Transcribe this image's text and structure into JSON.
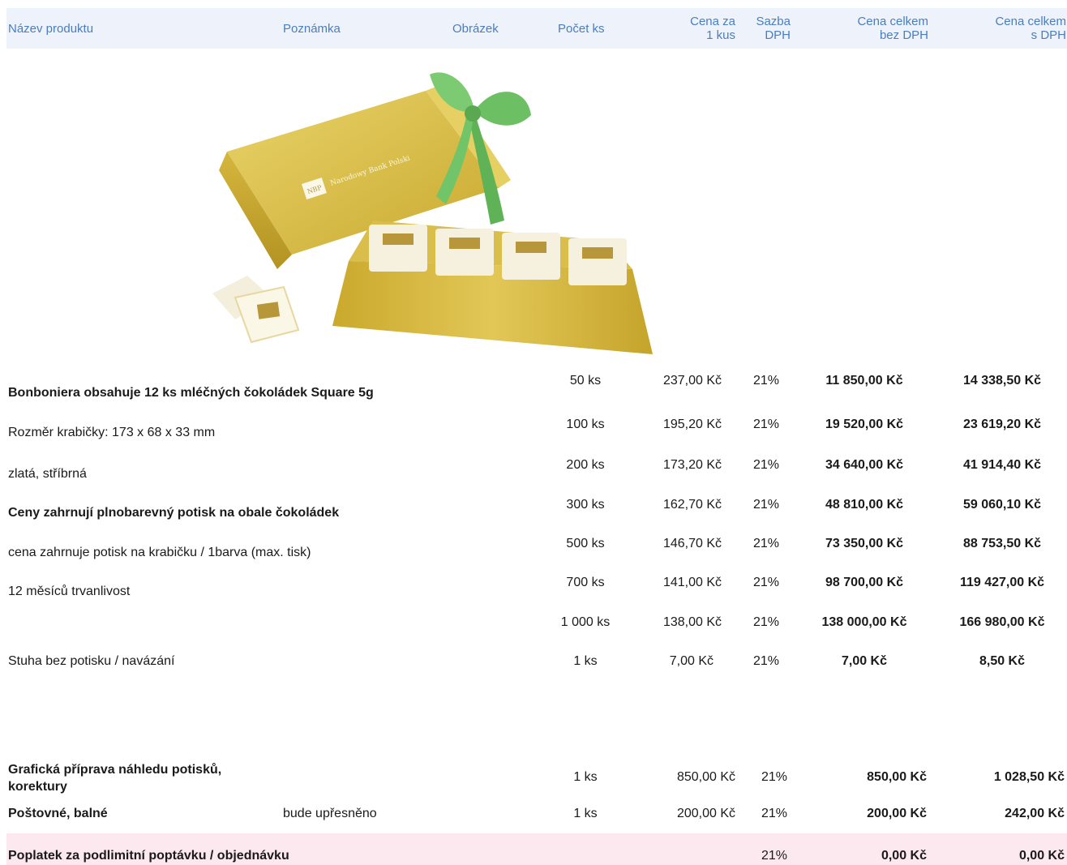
{
  "header": {
    "name": "Název produktu",
    "note": "Poznámka",
    "image": "Obrázek",
    "qty": "Počet ks",
    "unit_price_l1": "Cena za",
    "unit_price_l2": "1 kus",
    "vat_l1": "Sazba",
    "vat_l2": "DPH",
    "total_ex_l1": "Cena celkem",
    "total_ex_l2": "bez DPH",
    "total_inc_l1": "Cena celkem",
    "total_inc_l2": "s DPH"
  },
  "product_image": {
    "box_label": "Narodowy Bank Polski",
    "logo": "NBP"
  },
  "description": [
    "Bonboniera obsahuje 12 ks mléčných čokoládek Square 5g",
    "Rozměr krabičky: 173 x 68 x 33 mm",
    "zlatá, stříbrná",
    "Ceny zahrnují plnobarevný potisk na obale čokoládek",
    "cena zahrnuje potisk na krabičku / 1barva (max. tisk)",
    "12 měsíců trvanlivost"
  ],
  "price_rows": [
    {
      "qty": "50 ks",
      "unit": "237,00 Kč",
      "vat": "21%",
      "total_ex": "11 850,00 Kč",
      "total_inc": "14 338,50 Kč"
    },
    {
      "qty": "100 ks",
      "unit": "195,20 Kč",
      "vat": "21%",
      "total_ex": "19 520,00 Kč",
      "total_inc": "23 619,20 Kč"
    },
    {
      "qty": "200 ks",
      "unit": "173,20 Kč",
      "vat": "21%",
      "total_ex": "34 640,00 Kč",
      "total_inc": "41 914,40 Kč"
    },
    {
      "qty": "300 ks",
      "unit": "162,70 Kč",
      "vat": "21%",
      "total_ex": "48 810,00 Kč",
      "total_inc": "59 060,10 Kč"
    },
    {
      "qty": "500 ks",
      "unit": "146,70 Kč",
      "vat": "21%",
      "total_ex": "73 350,00 Kč",
      "total_inc": "88 753,50 Kč"
    },
    {
      "qty": "700 ks",
      "unit": "141,00 Kč",
      "vat": "21%",
      "total_ex": "98 700,00 Kč",
      "total_inc": "119 427,00 Kč"
    },
    {
      "qty": "1 000 ks",
      "unit": "138,00 Kč",
      "vat": "21%",
      "total_ex": "138 000,00 Kč",
      "total_inc": "166 980,00 Kč"
    }
  ],
  "ribbon": {
    "name": "Stuha bez potisku / navázání",
    "qty": "1 ks",
    "unit": "7,00 Kč",
    "vat": "21%",
    "total_ex": "7,00 Kč",
    "total_inc": "8,50 Kč"
  },
  "graphics": {
    "name_l1": "Grafická příprava náhledu potisků,",
    "name_l2": "korektury",
    "qty": "1 ks",
    "unit": "850,00 Kč",
    "vat": "21%",
    "total_ex": "850,00 Kč",
    "total_inc": "1 028,50 Kč"
  },
  "shipping": {
    "name": "Poštovné, balné",
    "note": "bude upřesněno",
    "qty": "1 ks",
    "unit": "200,00 Kč",
    "vat": "21%",
    "total_ex": "200,00 Kč",
    "total_inc": "242,00 Kč"
  },
  "fee": {
    "name": "Poplatek za podlimitní poptávku / objednávku",
    "vat": "21%",
    "total_ex": "0,00 Kč",
    "total_inc": "0,00 Kč"
  },
  "colors": {
    "header_bg": "#eef3fb",
    "header_text": "#4a7dc0",
    "fee_bg": "#fbe9ef",
    "ribbon": "#6cc06a",
    "gold": "#cfb23a"
  }
}
